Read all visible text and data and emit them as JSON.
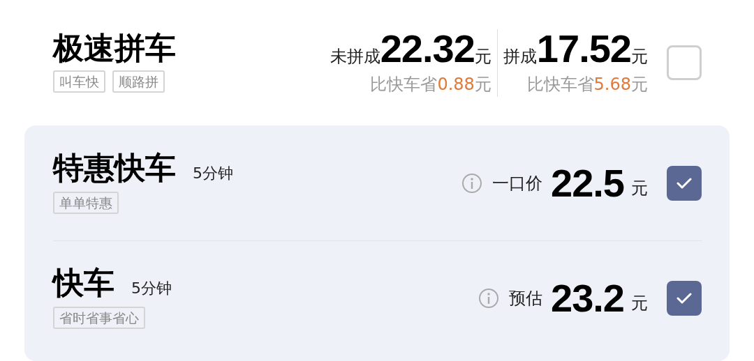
{
  "options": [
    {
      "kind": "carpool",
      "name": "极速拼车",
      "tags": [
        "叫车快",
        "顺路拼"
      ],
      "checked": false,
      "prices": [
        {
          "label": "未拼成",
          "amount": "22.32",
          "unit": "元",
          "saving_label": "比快车省",
          "saving": "0.88",
          "saving_unit": "元"
        },
        {
          "label": "拼成",
          "amount": "17.52",
          "unit": "元",
          "saving_label": "比快车省",
          "saving": "5.68",
          "saving_unit": "元"
        }
      ]
    },
    {
      "kind": "single",
      "name": "特惠快车",
      "eta": "5分钟",
      "tags": [
        "单单特惠"
      ],
      "price_label": "一口价",
      "amount": "22.5",
      "unit": "元",
      "checked": true
    },
    {
      "kind": "single",
      "name": "快车",
      "eta": "5分钟",
      "tags": [
        "省时省事省心"
      ],
      "price_label": "预估",
      "amount": "23.2",
      "unit": "元",
      "checked": true
    }
  ]
}
